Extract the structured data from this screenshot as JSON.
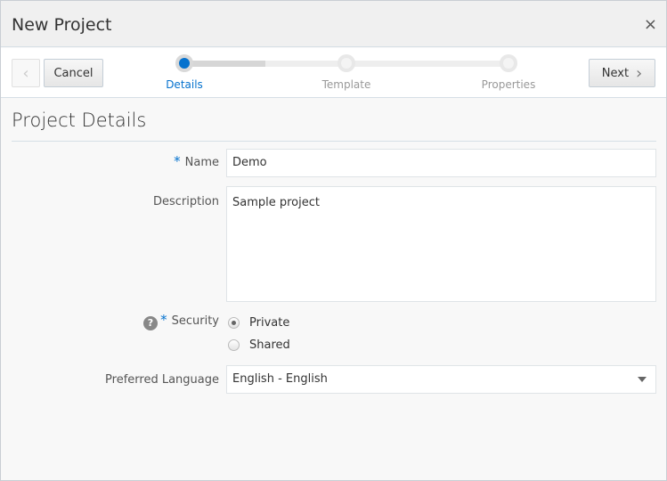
{
  "dialog": {
    "title": "New Project",
    "close_icon": "×"
  },
  "toolbar": {
    "prev_icon": "‹",
    "cancel": "Cancel",
    "next": "Next",
    "next_icon": "›"
  },
  "train": {
    "steps": [
      {
        "label": "Details",
        "current": true
      },
      {
        "label": "Template",
        "current": false
      },
      {
        "label": "Properties",
        "current": false
      }
    ],
    "progress_fraction": 0.25
  },
  "form": {
    "section_title": "Project Details",
    "required_mark": "*",
    "name_label": "Name",
    "name_value": "Demo",
    "description_label": "Description",
    "description_value": "Sample project",
    "help_icon": "?",
    "security_label": "Security",
    "security_options": [
      {
        "label": "Private",
        "selected": true
      },
      {
        "label": "Shared",
        "selected": false
      }
    ],
    "language_label": "Preferred Language",
    "language_value": "English - English"
  },
  "colors": {
    "accent": "#0572ce"
  }
}
